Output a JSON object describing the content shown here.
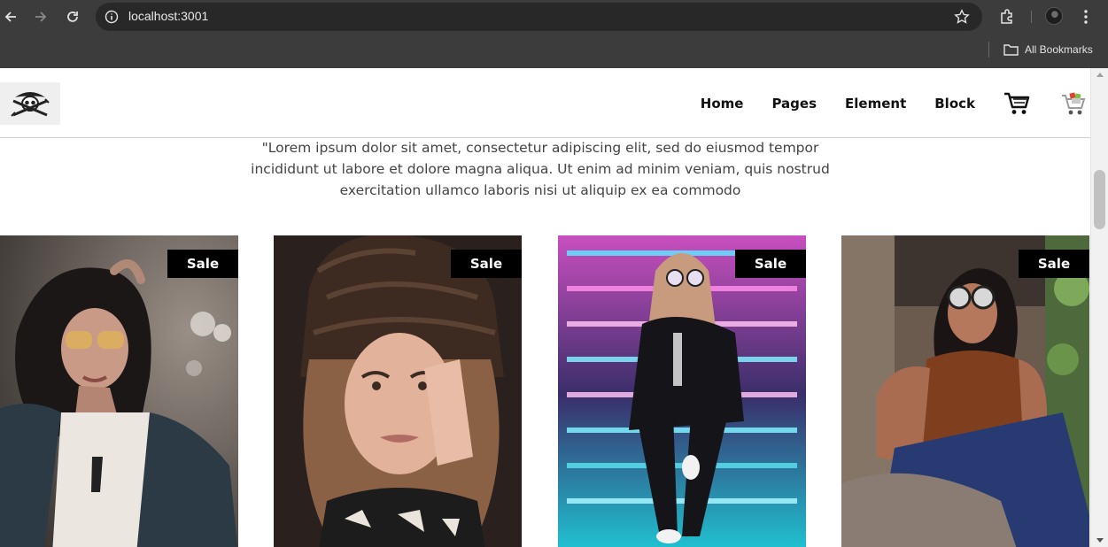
{
  "browser": {
    "url": "localhost:3001",
    "bookmarks_label": "All Bookmarks"
  },
  "site": {
    "nav": [
      {
        "label": "Home"
      },
      {
        "label": "Pages"
      },
      {
        "label": "Element"
      },
      {
        "label": "Block"
      }
    ],
    "intro_text": "\"Lorem ipsum dolor sit amet, consectetur adipiscing elit, sed do eiusmod tempor incididunt ut labore et dolore magna aliqua. Ut enim ad minim veniam, quis nostrud exercitation ullamco laboris nisi ut aliquip ex ea commodo",
    "products": [
      {
        "badge": "Sale"
      },
      {
        "badge": "Sale"
      },
      {
        "badge": "Sale"
      },
      {
        "badge": "Sale"
      }
    ]
  },
  "colors": {
    "chrome_bg": "#3c3c3c",
    "omnibox_bg": "#282828",
    "badge_bg": "#000000",
    "badge_text": "#ffffff",
    "nav_text": "#111111",
    "body_text": "#444444"
  },
  "icons": [
    "back-icon",
    "forward-icon",
    "reload-icon",
    "info-icon",
    "star-icon",
    "extensions-icon",
    "menu-icon",
    "folder-icon",
    "pirate-skull-logo",
    "cart-icon",
    "colored-cart-icon"
  ]
}
